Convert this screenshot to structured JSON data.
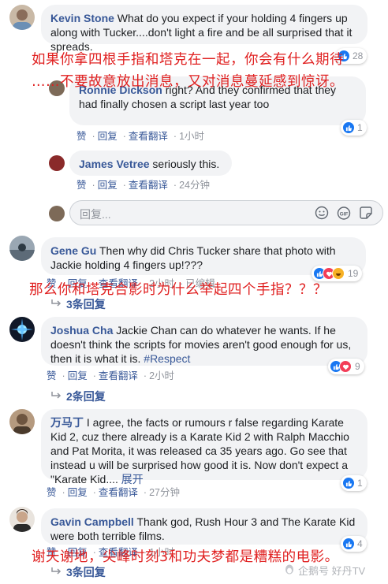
{
  "actions": {
    "like": "赞",
    "reply": "回复",
    "translate": "查看翻译",
    "dot": "·",
    "edited": "已编辑",
    "expand": "展开"
  },
  "comments": [
    {
      "author": "Kevin Stone",
      "text": "What do you expect if your holding 4 fingers up along with Tucker....don't light a fire and be all surprised that it spreads.",
      "reaction_count": "28"
    },
    {
      "author": "Ronnie Dickson",
      "text": "right? And they confirmed that they had finally chosen a script last year too",
      "time": "1小时",
      "reaction_count": "1"
    },
    {
      "author": "James Vetree",
      "text": "seriously this.",
      "time": "24分钟"
    },
    {
      "author": "Gene Gu",
      "text": "Then why did Chris Tucker share that photo with Jackie holding 4 fingers up!???",
      "time": "2小时",
      "reaction_count": "19",
      "replies": "3条回复"
    },
    {
      "author": "Joshua Cha",
      "text": "Jackie Chan can do whatever he wants. If he doesn't think the scripts for movies aren't good enough for us, then it is what it is.",
      "hashtag": "#Respect",
      "time": "2小时",
      "reaction_count": "9",
      "replies": "2条回复"
    },
    {
      "author": "万马丁",
      "text": "I agree, the facts or rumours r false regarding Karate Kid 2, cuz there already is a Karate Kid 2 with Ralph Macchio and Pat Morita, it was released ca 35 years ago. Go see that instead u will be surprised how good it is. Now don't expect a \"Karate Kid....",
      "time": "27分钟",
      "reaction_count": "1"
    },
    {
      "author": "Gavin Campbell",
      "text": "Thank god, Rush Hour 3 and The Karate Kid were both terrible films.",
      "time": "1小时",
      "reaction_count": "4",
      "replies": "3条回复"
    }
  ],
  "reply_input": {
    "placeholder": "回复..."
  },
  "overlay": {
    "line1": "如果你拿四根手指和塔克在一起，你会有什么期待",
    "line2": "……不要故意放出消息，又对消息蔓延感到惊讶。",
    "line3": "那么你和塔克合影时为什么举起四个手指？？？",
    "line4": "谢天谢地，尖峰时刻3和功夫梦都是糟糕的电影。"
  },
  "watermark": "企鹅号 好丹TV",
  "colors": {
    "link": "#385898",
    "overlay_red": "#e02020",
    "like_blue": "#1877f2"
  }
}
